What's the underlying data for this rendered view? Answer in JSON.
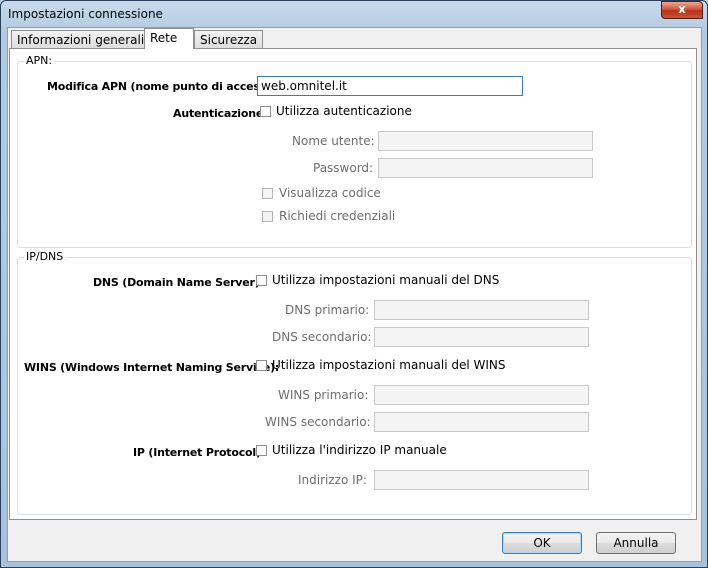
{
  "window": {
    "title": "Impostazioni connessione",
    "close_glyph": "x"
  },
  "tabs": [
    {
      "label": "Informazioni generali",
      "active": false
    },
    {
      "label": "Rete",
      "active": true
    },
    {
      "label": "Sicurezza",
      "active": false
    }
  ],
  "apn": {
    "group_label": "APN:",
    "modifica_label": "Modifica APN (nome punto di accesso)",
    "apn_value": "web.omnitel.it",
    "auth_label": "Autenticazione",
    "use_auth": "Utilizza autenticazione",
    "username_label": "Nome utente:",
    "password_label": "Password:",
    "show_code": "Visualizza codice",
    "ask_credentials": "Richiedi credenziali"
  },
  "ipdns": {
    "group_label": "IP/DNS",
    "dns_label": "DNS (Domain Name Server):",
    "dns_manual": "Utilizza impostazioni manuali del DNS",
    "dns_primary": "DNS primario:",
    "dns_secondary": "DNS secondario:",
    "wins_label": "WINS (Windows Internet Naming Service):",
    "wins_manual": "Utilizza impostazioni manuali del WINS",
    "wins_primary": "WINS primario:",
    "wins_secondary": "WINS secondario:",
    "ip_label": "IP (Internet Protocol):",
    "ip_manual": "Utilizza l'indirizzo IP manuale",
    "ip_address": "Indirizzo IP:"
  },
  "buttons": {
    "ok": "OK",
    "cancel": "Annulla"
  },
  "colors": {
    "titlebar": "#b3cbe2",
    "close": "#c8553a",
    "default_button": "#3c7fb1"
  }
}
